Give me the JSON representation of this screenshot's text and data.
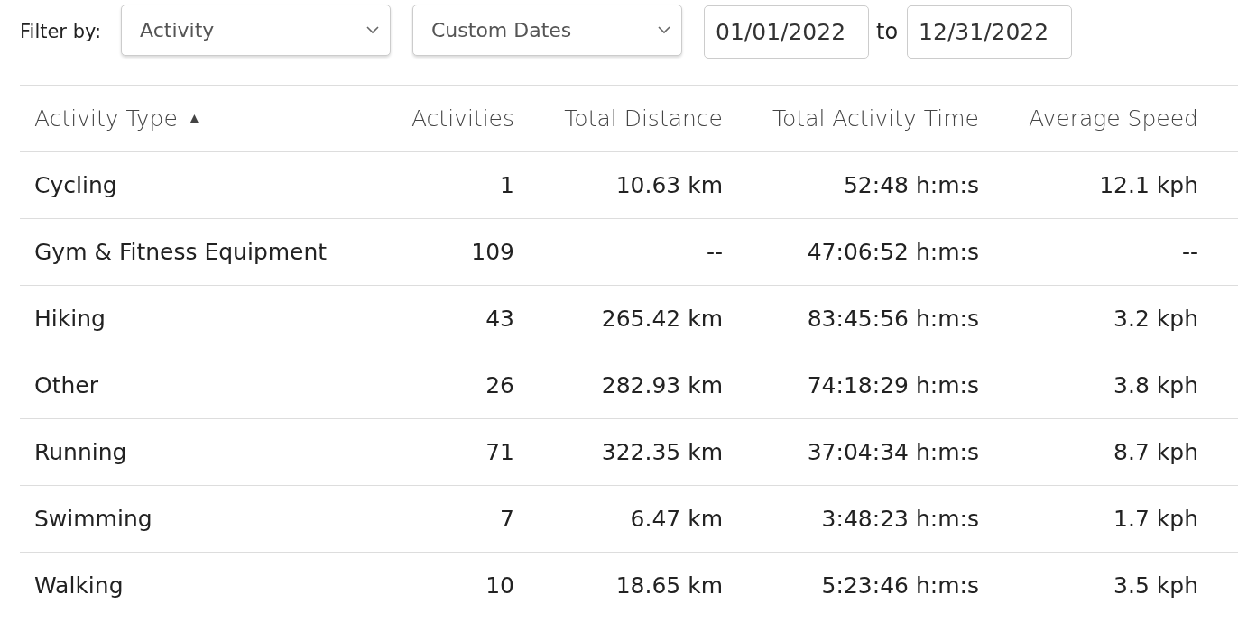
{
  "filter_bar": {
    "label": "Filter by:",
    "activity_select": {
      "value": "Activity"
    },
    "date_range_select": {
      "value": "Custom Dates"
    },
    "start_date": {
      "value": "01/01/2022"
    },
    "separator": "to",
    "end_date": {
      "value": "12/31/2022"
    }
  },
  "table": {
    "columns": [
      {
        "label": "Activity Type",
        "sort_indicator": "▲"
      },
      {
        "label": "Activities"
      },
      {
        "label": "Total Distance"
      },
      {
        "label": "Total Activity Time"
      },
      {
        "label": "Average Speed"
      }
    ],
    "rows": [
      [
        "Cycling",
        "1",
        "10.63 km",
        "52:48 h:m:s",
        "12.1 kph"
      ],
      [
        "Gym & Fitness Equipment",
        "109",
        "--",
        "47:06:52 h:m:s",
        "--"
      ],
      [
        "Hiking",
        "43",
        "265.42 km",
        "83:45:56 h:m:s",
        "3.2 kph"
      ],
      [
        "Other",
        "26",
        "282.93 km",
        "74:18:29 h:m:s",
        "3.8 kph"
      ],
      [
        "Running",
        "71",
        "322.35 km",
        "37:04:34 h:m:s",
        "8.7 kph"
      ],
      [
        "Swimming",
        "7",
        "6.47 km",
        "3:48:23 h:m:s",
        "1.7 kph"
      ],
      [
        "Walking",
        "10",
        "18.65 km",
        "5:23:46 h:m:s",
        "3.5 kph"
      ]
    ]
  }
}
